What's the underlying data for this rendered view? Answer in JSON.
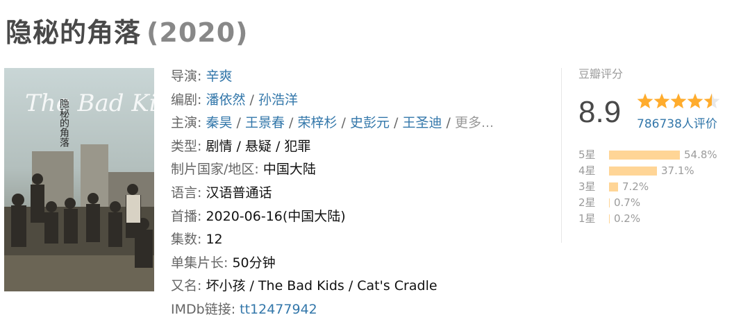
{
  "title": "隐秘的角落",
  "year": "(2020)",
  "poster": {
    "text_lines": [
      "The Bad Kids",
      "隐秘的角落"
    ]
  },
  "info": {
    "director_label": "导演: ",
    "director": "辛爽",
    "writer_label": "编剧: ",
    "writers": [
      "潘依然",
      "孙浩洋"
    ],
    "cast_label": "主演: ",
    "cast": [
      "秦昊",
      "王景春",
      "荣梓杉",
      "史彭元",
      "王圣迪"
    ],
    "cast_more": "更多...",
    "genre_label": "类型: ",
    "genre": "剧情 / 悬疑 / 犯罪",
    "country_label": "制片国家/地区: ",
    "country": "中国大陆",
    "language_label": "语言: ",
    "language": "汉语普通话",
    "premiere_label": "首播: ",
    "premiere": "2020-06-16(中国大陆)",
    "episodes_label": "集数: ",
    "episodes": "12",
    "runtime_label": "单集片长: ",
    "runtime": "50分钟",
    "aka_label": "又名: ",
    "aka": "坏小孩 / The Bad Kids / Cat's Cradle",
    "imdb_label": "IMDb链接: ",
    "imdb": "tt12477942",
    "separator": " / "
  },
  "rating": {
    "header": "豆瓣评分",
    "score": "8.9",
    "stars": 4.5,
    "votes": "786738人评价",
    "distribution": [
      {
        "label": "5星",
        "percent": 54.8,
        "text": "54.8%"
      },
      {
        "label": "4星",
        "percent": 37.1,
        "text": "37.1%"
      },
      {
        "label": "3星",
        "percent": 7.2,
        "text": "7.2%"
      },
      {
        "label": "2星",
        "percent": 0.7,
        "text": "0.7%"
      },
      {
        "label": "1星",
        "percent": 0.2,
        "text": "0.2%"
      }
    ],
    "colors": {
      "star": "#ffac2d",
      "star_empty": "#e8e8e8",
      "bar": "#ffd596",
      "link": "#3377aa"
    }
  }
}
